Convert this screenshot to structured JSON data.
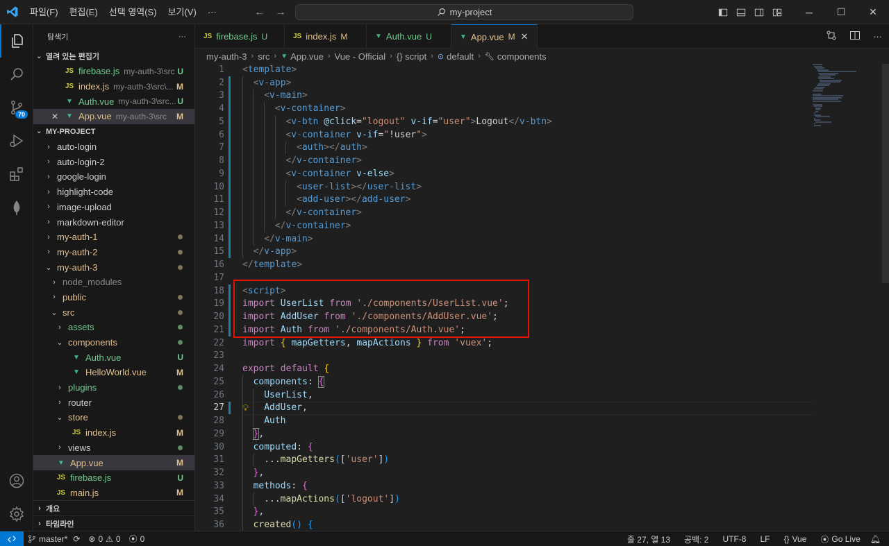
{
  "titlebar": {
    "menu": [
      "파일(F)",
      "편집(E)",
      "선택 영역(S)",
      "보기(V)",
      "···"
    ],
    "search": "my-project"
  },
  "activity": {
    "scm_badge": "70"
  },
  "sidebar": {
    "title": "탐색기",
    "more": "···",
    "open_editors_title": "열려 있는 편집기",
    "open_editors": [
      {
        "name": "firebase.js",
        "path": "my-auth-3\\src",
        "status": "U",
        "type": "js"
      },
      {
        "name": "index.js",
        "path": "my-auth-3\\src\\...",
        "status": "M",
        "type": "js"
      },
      {
        "name": "Auth.vue",
        "path": "my-auth-3\\src...",
        "status": "U",
        "type": "vue"
      },
      {
        "name": "App.vue",
        "path": "my-auth-3\\src",
        "status": "M",
        "type": "vue"
      }
    ],
    "project_title": "MY-PROJECT",
    "tree": [
      {
        "label": "auto-login"
      },
      {
        "label": "auto-login-2"
      },
      {
        "label": "google-login"
      },
      {
        "label": "highlight-code"
      },
      {
        "label": "image-upload"
      },
      {
        "label": "markdown-editor"
      },
      {
        "label": "my-auth-1"
      },
      {
        "label": "my-auth-2"
      },
      {
        "label": "my-auth-3"
      },
      {
        "label": "node_modules"
      },
      {
        "label": "public"
      },
      {
        "label": "src"
      },
      {
        "label": "assets"
      },
      {
        "label": "components"
      },
      {
        "label": "Auth.vue",
        "status": "U"
      },
      {
        "label": "HelloWorld.vue",
        "status": "M"
      },
      {
        "label": "plugins"
      },
      {
        "label": "router"
      },
      {
        "label": "store"
      },
      {
        "label": "index.js",
        "status": "M"
      },
      {
        "label": "views"
      },
      {
        "label": "App.vue",
        "status": "M"
      },
      {
        "label": "firebase.js",
        "status": "U"
      },
      {
        "label": "main.js",
        "status": "M"
      }
    ],
    "outline": "개요",
    "timeline": "타임라인"
  },
  "tabs": [
    {
      "name": "firebase.js",
      "status": "U"
    },
    {
      "name": "index.js",
      "status": "M"
    },
    {
      "name": "Auth.vue",
      "status": "U"
    },
    {
      "name": "App.vue",
      "status": "M"
    }
  ],
  "breadcrumb": [
    "my-auth-3",
    "src",
    "App.vue",
    "Vue - Official",
    "{} script",
    "default",
    "components"
  ],
  "editor": {
    "line_numbers": [
      "1",
      "2",
      "3",
      "4",
      "5",
      "6",
      "7",
      "8",
      "9",
      "10",
      "11",
      "12",
      "13",
      "14",
      "15",
      "16",
      "17",
      "18",
      "19",
      "20",
      "21",
      "22",
      "23",
      "24",
      "25",
      "26",
      "27",
      "28",
      "29",
      "30",
      "31",
      "32",
      "33",
      "34",
      "35",
      "36"
    ]
  },
  "statusbar": {
    "branch": "master*",
    "errors": "0",
    "warnings": "0",
    "ports": "0",
    "position": "줄 27, 열 13",
    "spaces": "공백: 2",
    "encoding": "UTF-8",
    "eol": "LF",
    "language": "Vue",
    "golive": "Go Live"
  },
  "colors": {
    "accent": "#0078d4",
    "modified": "#e2c08d",
    "untracked": "#73c991",
    "highlight_box": "#e51400"
  }
}
